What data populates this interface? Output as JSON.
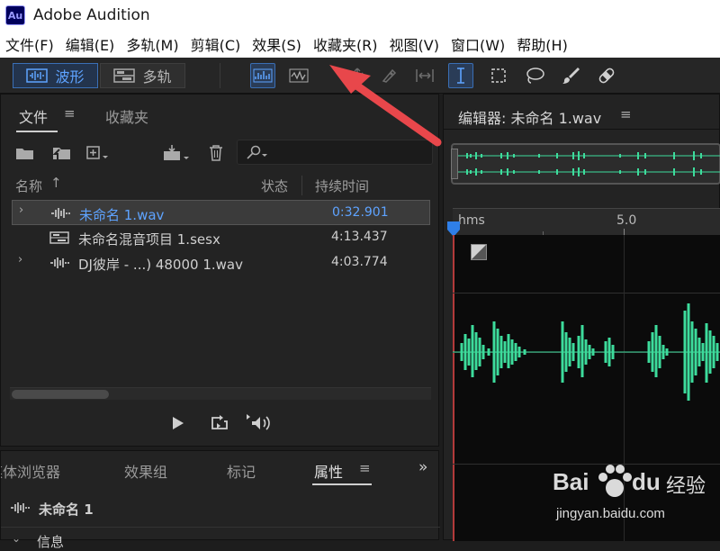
{
  "app": {
    "logo_text": "Au",
    "title": "Adobe Audition"
  },
  "menu": [
    "文件(F)",
    "编辑(E)",
    "多轨(M)",
    "剪辑(C)",
    "效果(S)",
    "收藏夹(R)",
    "视图(V)",
    "窗口(W)",
    "帮助(H)"
  ],
  "toolbar": {
    "waveform_label": "波形",
    "multitrack_label": "多轨",
    "view_mode": "waveform",
    "active_tool": "time-selection"
  },
  "files_panel": {
    "tabs": [
      "文件",
      "收藏夹"
    ],
    "active_tab": "文件",
    "search_placeholder": "",
    "columns": {
      "name": "名称",
      "status": "状态",
      "duration": "持续时间"
    },
    "rows": [
      {
        "name": "未命名 1.wav",
        "status": "",
        "duration": "0:32.901",
        "type": "wave",
        "selected": true
      },
      {
        "name": "未命名混音项目 1.sesx",
        "status": "",
        "duration": "4:13.437",
        "type": "session",
        "selected": false
      },
      {
        "name": "DJ彼岸 - ...) 48000 1.wav",
        "status": "",
        "duration": "4:03.774",
        "type": "wave",
        "selected": false
      }
    ]
  },
  "bottom_panel": {
    "tabs": [
      "媒体浏览器",
      "效果组",
      "标记",
      "属性"
    ],
    "active_tab": "属性",
    "item_name": "未命名 1",
    "next_section": "信息"
  },
  "editor": {
    "title": "编辑器: 未命名 1.wav",
    "ruler_unit": "hms",
    "ruler_mark": "5.0"
  },
  "watermark": {
    "brand": "Bai",
    "brand2": "du",
    "cn": "经验",
    "url": "jingyan.baidu.com"
  },
  "colors": {
    "accent": "#5ea3ff",
    "waveform": "#3ddc9c",
    "arrow": "#e8474b",
    "playhead": "#2f7fe8"
  }
}
